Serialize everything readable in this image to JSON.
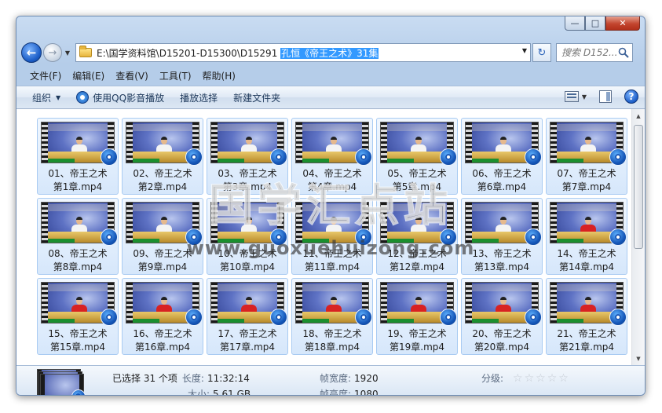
{
  "window": {
    "minimize_label": "—",
    "maximize_label": "□",
    "close_label": "✕"
  },
  "address": {
    "path_prefix": "E:\\国学资料馆\\D15201-D15300\\D15291",
    "path_selected": "孔恒《帝王之术》31集",
    "search_placeholder": "搜索 D152..."
  },
  "menu": [
    "文件(F)",
    "编辑(E)",
    "查看(V)",
    "工具(T)",
    "帮助(H)"
  ],
  "commands": {
    "organize": "组织",
    "play_qq": "使用QQ影音播放",
    "play_selected": "播放选择",
    "new_folder": "新建文件夹",
    "help": "?"
  },
  "files": [
    {
      "line1": "01、帝王之术",
      "line2": "第1章.mp4",
      "shirt": "white"
    },
    {
      "line1": "02、帝王之术",
      "line2": "第2章.mp4",
      "shirt": "white"
    },
    {
      "line1": "03、帝王之术",
      "line2": "第3章.mp4",
      "shirt": "white"
    },
    {
      "line1": "04、帝王之术",
      "line2": "第4章.mp4",
      "shirt": "white"
    },
    {
      "line1": "05、帝王之术",
      "line2": "第5章.mp4",
      "shirt": "white"
    },
    {
      "line1": "06、帝王之术",
      "line2": "第6章.mp4",
      "shirt": "white"
    },
    {
      "line1": "07、帝王之术",
      "line2": "第7章.mp4",
      "shirt": "white"
    },
    {
      "line1": "08、帝王之术",
      "line2": "第8章.mp4",
      "shirt": "white"
    },
    {
      "line1": "09、帝王之术",
      "line2": "第9章.mp4",
      "shirt": "white"
    },
    {
      "line1": "10、帝王之术",
      "line2": "第10章.mp4",
      "shirt": "white"
    },
    {
      "line1": "11、帝王之术",
      "line2": "第11章.mp4",
      "shirt": "white"
    },
    {
      "line1": "12、帝王之术",
      "line2": "第12章.mp4",
      "shirt": "white"
    },
    {
      "line1": "13、帝王之术",
      "line2": "第13章.mp4",
      "shirt": "white"
    },
    {
      "line1": "14、帝王之术",
      "line2": "第14章.mp4",
      "shirt": "red"
    },
    {
      "line1": "15、帝王之术",
      "line2": "第15章.mp4",
      "shirt": "red"
    },
    {
      "line1": "16、帝王之术",
      "line2": "第16章.mp4",
      "shirt": "red"
    },
    {
      "line1": "17、帝王之术",
      "line2": "第17章.mp4",
      "shirt": "red"
    },
    {
      "line1": "18、帝王之术",
      "line2": "第18章.mp4",
      "shirt": "red"
    },
    {
      "line1": "19、帝王之术",
      "line2": "第19章.mp4",
      "shirt": "red"
    },
    {
      "line1": "20、帝王之术",
      "line2": "第20章.mp4",
      "shirt": "red"
    },
    {
      "line1": "21、帝王之术",
      "line2": "第21章.mp4",
      "shirt": "red"
    }
  ],
  "watermark": {
    "title": "国学汇点站",
    "url": "www.guoxuehuizong.com"
  },
  "details": {
    "selected": "已选择 31 个项",
    "length_key": "长度:",
    "length_val": "11:32:14",
    "size_key": "大小:",
    "size_val": "5.61 GB",
    "frame_width_key": "帧宽度:",
    "frame_width_val": "1920",
    "frame_height_key": "帧高度:",
    "frame_height_val": "1080",
    "rating_key": "分级:",
    "rating_stars": 0
  },
  "colors": {
    "selection": "#3399ff",
    "tile_border": "#a9cbf2",
    "accent": "#1b5dc7"
  }
}
